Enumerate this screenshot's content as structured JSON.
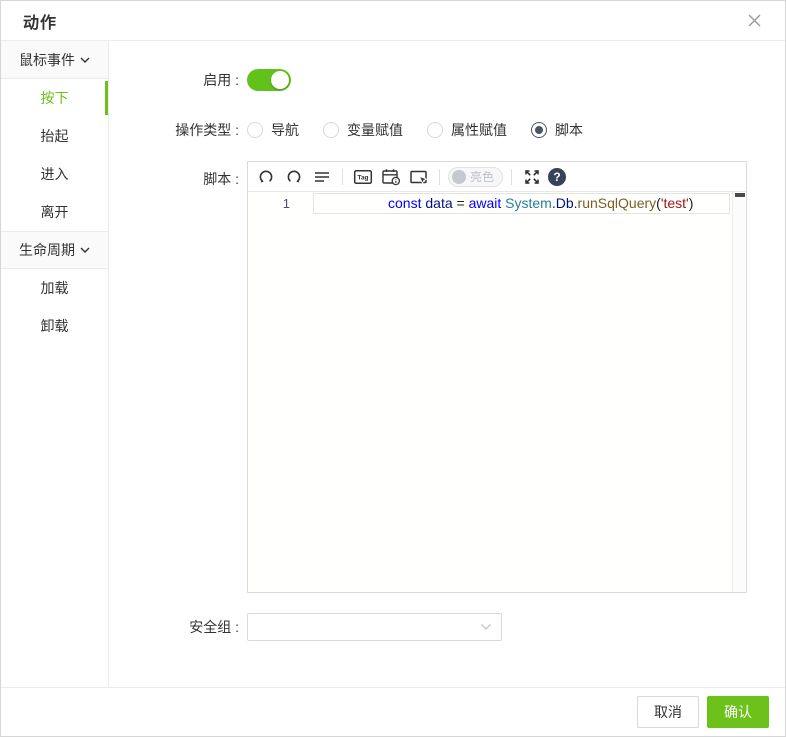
{
  "dialog": {
    "title": "动作"
  },
  "sidebar": {
    "groups": [
      {
        "label": "鼠标事件",
        "items": [
          {
            "label": "按下",
            "active": true
          },
          {
            "label": "抬起",
            "active": false
          },
          {
            "label": "进入",
            "active": false
          },
          {
            "label": "离开",
            "active": false
          }
        ]
      },
      {
        "label": "生命周期",
        "items": [
          {
            "label": "加载",
            "active": false
          },
          {
            "label": "卸载",
            "active": false
          }
        ]
      }
    ]
  },
  "form": {
    "enable_label": "启用 :",
    "enable_state": "on",
    "action_type_label": "操作类型 :",
    "action_type_options": [
      {
        "label": "导航",
        "selected": false
      },
      {
        "label": "变量赋值",
        "selected": false
      },
      {
        "label": "属性赋值",
        "selected": false
      },
      {
        "label": "脚本",
        "selected": true
      }
    ],
    "script_label": "脚本 :",
    "security_group_label": "安全组 :",
    "security_group_value": ""
  },
  "editor": {
    "toolbar": {
      "tag_label": "Tag",
      "light_toggle_label": "亮色",
      "help_glyph": "?"
    },
    "line_number": "1",
    "code_plain": "const data = await System.Db.runSqlQuery('test')",
    "tokens": [
      {
        "text": "const",
        "color": "#0000ff"
      },
      {
        "text": " ",
        "color": "#1f1f1f"
      },
      {
        "text": "data",
        "color": "#001080"
      },
      {
        "text": " = ",
        "color": "#1f1f1f"
      },
      {
        "text": "await",
        "color": "#0000ff"
      },
      {
        "text": " ",
        "color": "#1f1f1f"
      },
      {
        "text": "System",
        "color": "#267f99"
      },
      {
        "text": ".",
        "color": "#1f1f1f"
      },
      {
        "text": "Db",
        "color": "#001080"
      },
      {
        "text": ".",
        "color": "#1f1f1f"
      },
      {
        "text": "runSqlQuery",
        "color": "#795e26"
      },
      {
        "text": "(",
        "color": "#1f1f1f"
      },
      {
        "text": "'test'",
        "color": "#a31515"
      },
      {
        "text": ")",
        "color": "#1f1f1f"
      }
    ]
  },
  "footer": {
    "cancel_label": "取消",
    "confirm_label": "确认"
  },
  "colors": {
    "accent_green": "#6cc21a",
    "radio_checked": "#4c5566",
    "help_badge": "#36435a",
    "border_light": "#ebebeb",
    "string_red": "#a31515",
    "keyword_blue": "#0000ff",
    "type_teal": "#267f99",
    "function_brown": "#795e26"
  }
}
